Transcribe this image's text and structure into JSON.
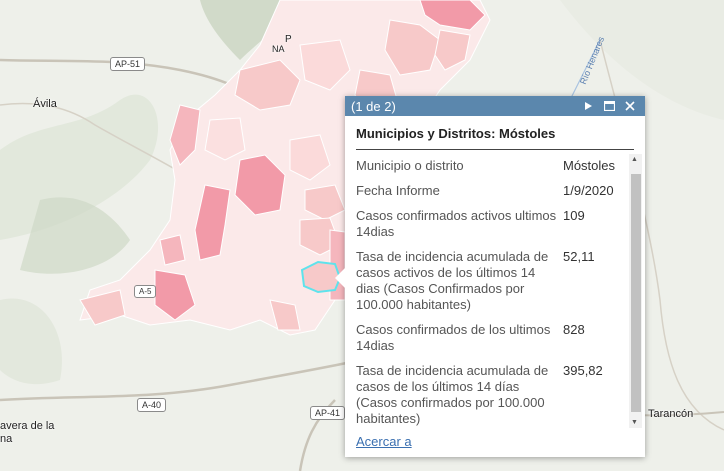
{
  "map": {
    "place_labels": {
      "avila": "Ávila",
      "talavera": "avera de la",
      "talavera2": "na",
      "tarancon": "Tarancón",
      "partial_p": "P",
      "partial_na": "NA"
    },
    "road_shields": {
      "ap51": "AP-51",
      "a40": "A-40",
      "ap41": "AP-41",
      "a5": "A-5"
    },
    "river_label": "Río Henares",
    "colors": {
      "background": "#eef0ea",
      "region_light": "#fbe9e9",
      "region_mid": "#f7c9c9",
      "region_strong": "#f29aa8",
      "highlight": "#5ee3ec"
    }
  },
  "popup": {
    "pager": "(1 de 2)",
    "title": "Municipios y Distritos: Móstoles",
    "attributes": [
      {
        "label": "Municipio o distrito",
        "value": "Móstoles"
      },
      {
        "label": "Fecha Informe",
        "value": "1/9/2020"
      },
      {
        "label": "Casos confirmados activos ultimos 14dias",
        "value": "109"
      },
      {
        "label": "Tasa de incidencia acumulada de casos activos de los últimos 14 dias (Casos Confirmados por 100.000 habitantes)",
        "value": "52,11"
      },
      {
        "label": "Casos confirmados de los ultimos 14dias",
        "value": "828"
      },
      {
        "label": "Tasa de incidencia acumulada de casos de los últimos 14 días (Casos confirmados por 100.000 habitantes)",
        "value": "395,82"
      }
    ],
    "zoom_label": "Acercar a",
    "icons": {
      "next": "play-icon",
      "maximize": "maximize-icon",
      "close": "close-icon"
    }
  }
}
